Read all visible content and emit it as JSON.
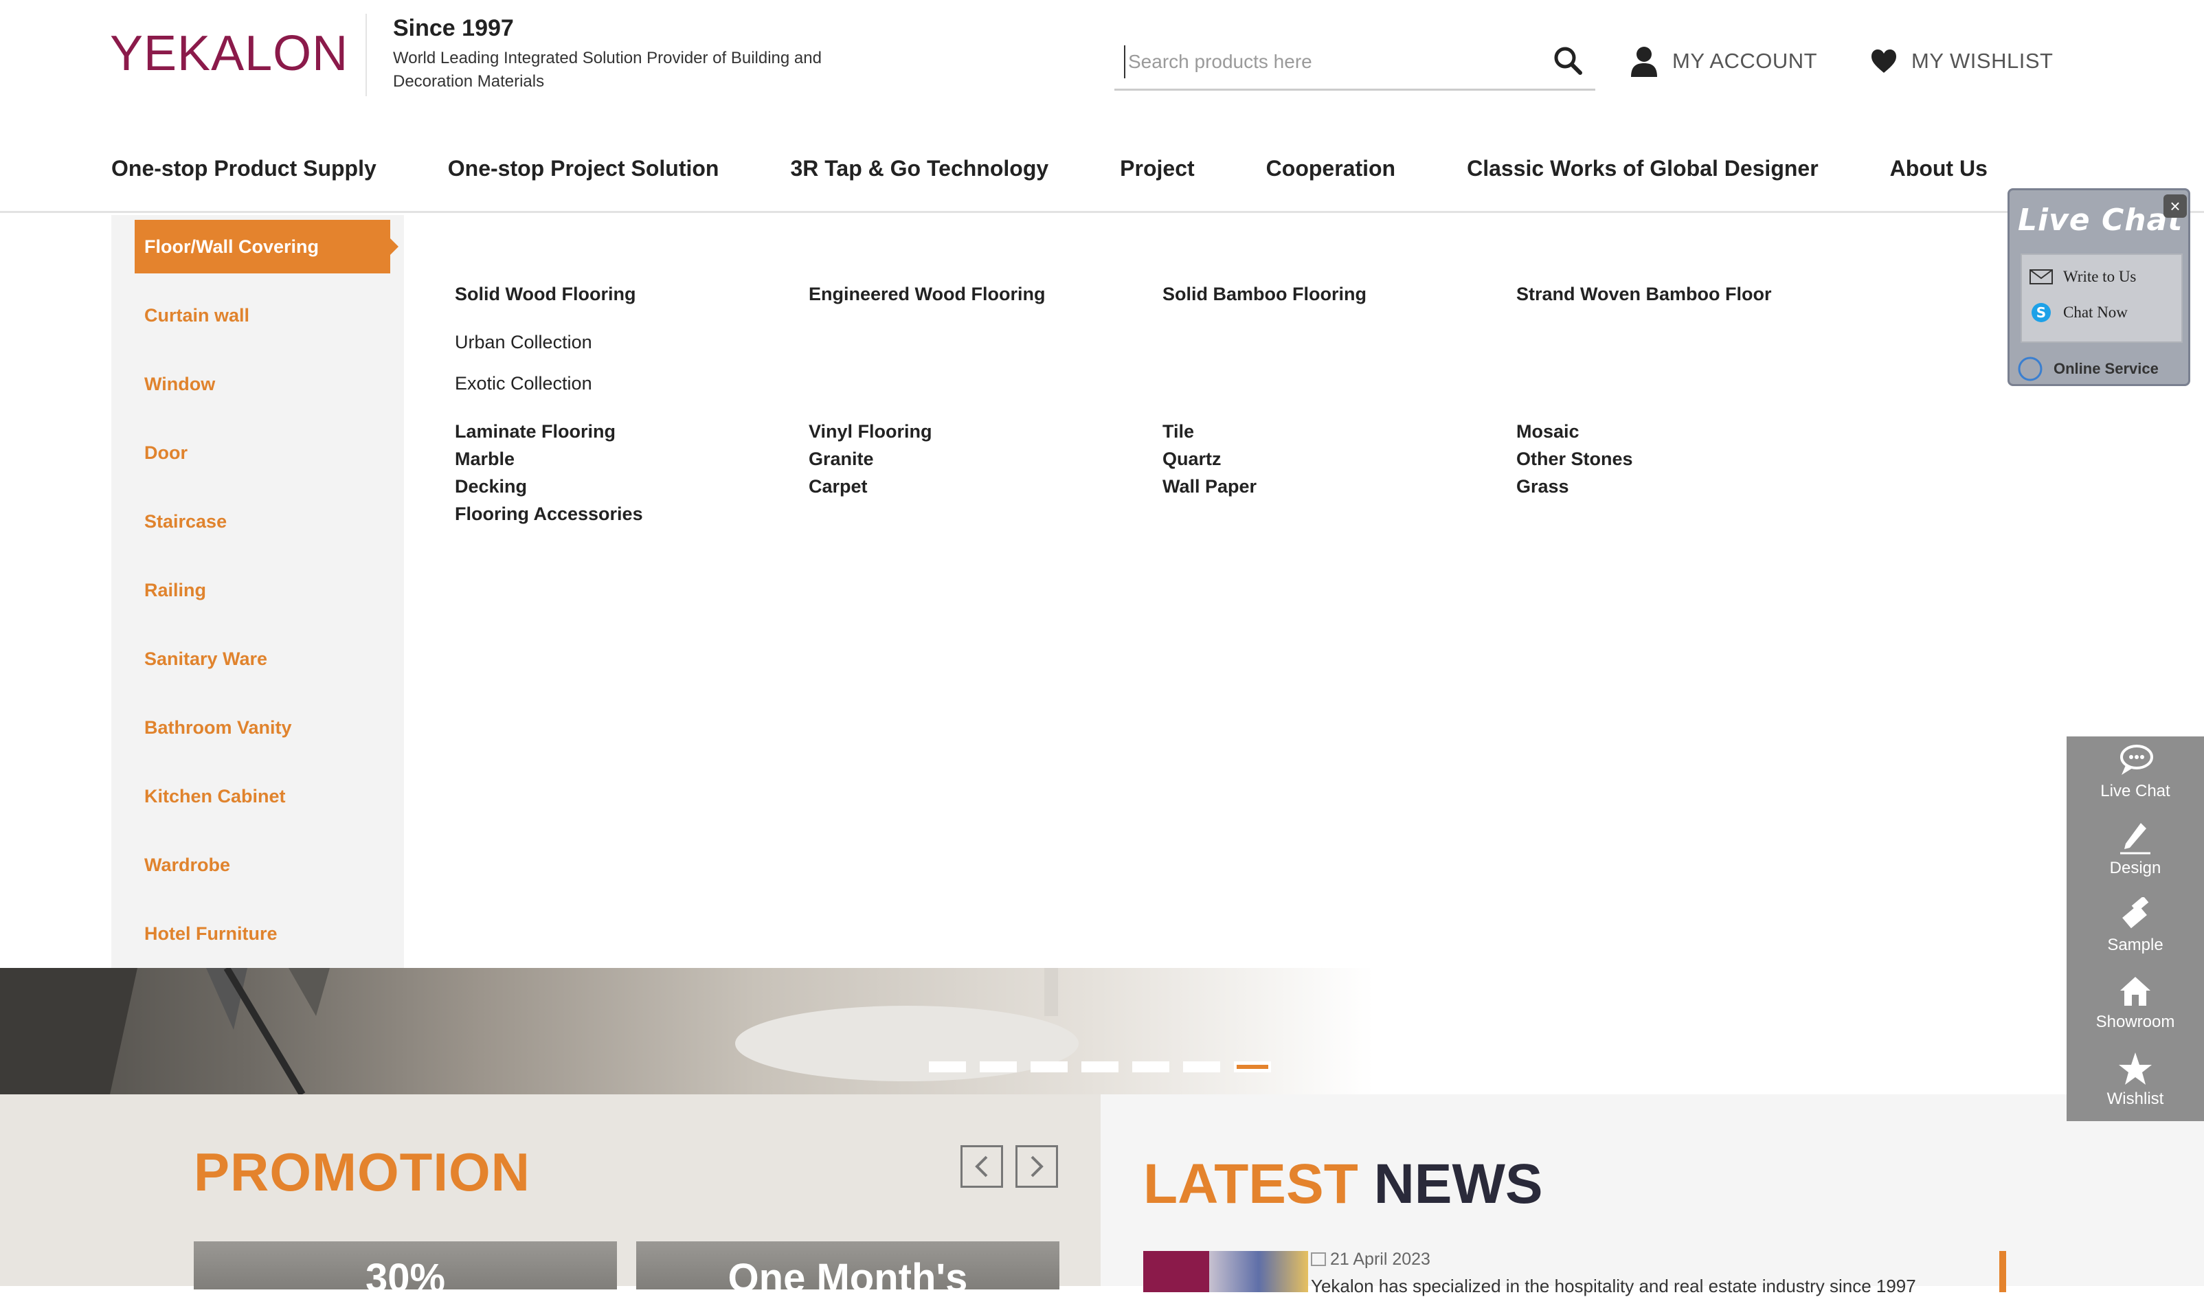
{
  "header": {
    "logo_text": "YEKALON",
    "since": "Since 1997",
    "tagline": "World Leading Integrated Solution Provider of Building and Decoration Materials",
    "search_placeholder": "Search products here",
    "account_label": "MY ACCOUNT",
    "wishlist_label": "MY WISHLIST",
    "icons": {
      "search": "search-icon",
      "account": "user-icon",
      "wishlist": "heart-icon"
    }
  },
  "nav": [
    "One-stop Product Supply",
    "One-stop Project Solution",
    "3R Tap & Go Technology",
    "Project",
    "Cooperation",
    "Classic Works of Global Designer",
    "About Us"
  ],
  "categories": [
    "Floor/Wall Covering",
    "Curtain wall",
    "Window",
    "Door",
    "Staircase",
    "Railing",
    "Sanitary Ware",
    "Bathroom Vanity",
    "Kitchen Cabinet",
    "Wardrobe",
    "Hotel Furniture"
  ],
  "active_category": "Floor/Wall Covering",
  "subcategories": {
    "solid_wood": "Solid Wood Flooring",
    "urban": "Urban Collection",
    "exotic": "Exotic Collection",
    "engineered": "Engineered Wood Flooring",
    "solid_bamboo": "Solid Bamboo Flooring",
    "strand_bamboo": "Strand Woven Bamboo Floor",
    "laminate": "Laminate Flooring",
    "marble": "Marble",
    "decking": "Decking",
    "accessories": "Flooring Accessories",
    "vinyl": "Vinyl Flooring",
    "granite": "Granite",
    "carpet": "Carpet",
    "tile": "Tile",
    "quartz": "Quartz",
    "wallpaper": "Wall Paper",
    "mosaic": "Mosaic",
    "other_stones": "Other Stones",
    "grass": "Grass"
  },
  "carousel": {
    "slide_count": 7,
    "active_index": 6
  },
  "promotion": {
    "title": "PROMOTION",
    "card1_text": "30%",
    "card2_text": "One Month's"
  },
  "news": {
    "title_part1": "LATEST",
    "title_part2": "NEWS",
    "date": "21 April 2023",
    "snippet": "Yekalon has specialized in the hospitality and real estate industry since 1997"
  },
  "live_chat": {
    "title": "Live Chat",
    "write_to_us": "Write to Us",
    "chat_now": "Chat Now",
    "online_service": "Online Service"
  },
  "sidebar": [
    "Live Chat",
    "Design",
    "Sample",
    "Showroom",
    "Wishlist"
  ],
  "colors": {
    "accent": "#e4832d",
    "brand": "#8b1a4a",
    "sidebar_bg": "#8e8e8e",
    "news_dark": "#2a2a3a"
  }
}
